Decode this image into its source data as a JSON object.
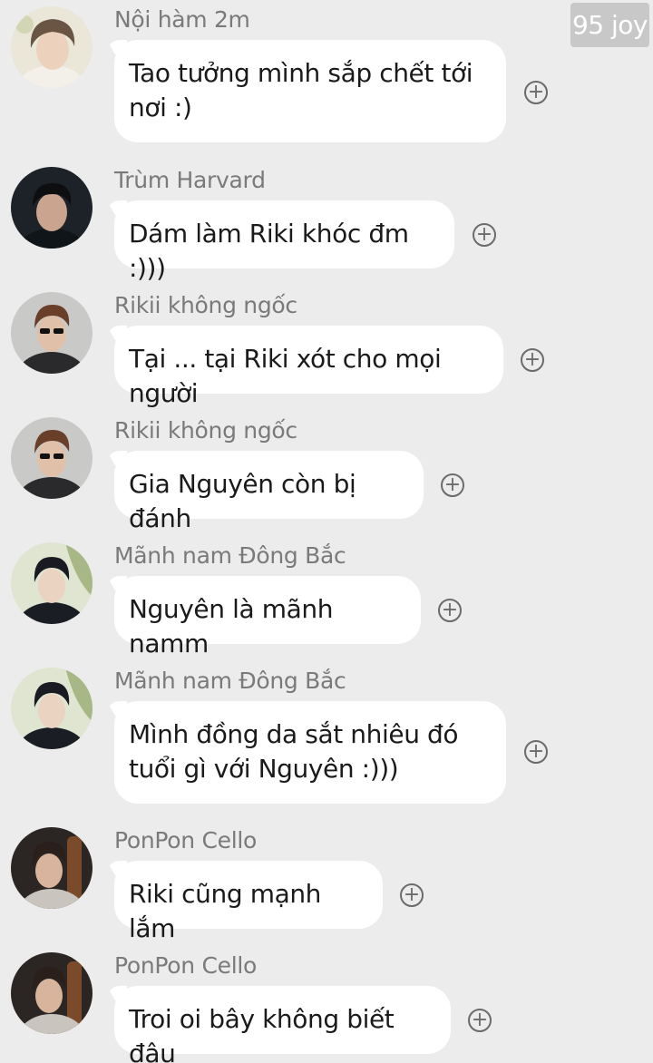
{
  "watermark": "95 joy",
  "icons": {
    "react": "add-reaction-icon"
  },
  "colors": {
    "background": "#ececec",
    "bubble": "#ffffff",
    "sender": "#7a7a7a",
    "text": "#1a1a1a"
  },
  "messages": [
    {
      "sender": "Nội hàm 2m",
      "text": "Tao tưởng mình sắp chết tới nơi :)"
    },
    {
      "sender": "Trùm Harvard",
      "text": "Dám làm Riki khóc đm :)))"
    },
    {
      "sender": "Rikii không ngốc",
      "text": "Tại ... tại Riki xót cho mọi người"
    },
    {
      "sender": "Rikii không ngốc",
      "text": "Gia Nguyên còn bị đánh"
    },
    {
      "sender": "Mãnh nam Đông Bắc",
      "text": "Nguyên là mãnh namm"
    },
    {
      "sender": "Mãnh nam Đông Bắc",
      "text": "Mình đồng da sắt nhiêu đó tuổi gì với Nguyên :)))"
    },
    {
      "sender": "PonPon Cello",
      "text": "Riki cũng mạnh lắm"
    },
    {
      "sender": "PonPon Cello",
      "text": "Troi oi bây không biết đâu"
    }
  ]
}
